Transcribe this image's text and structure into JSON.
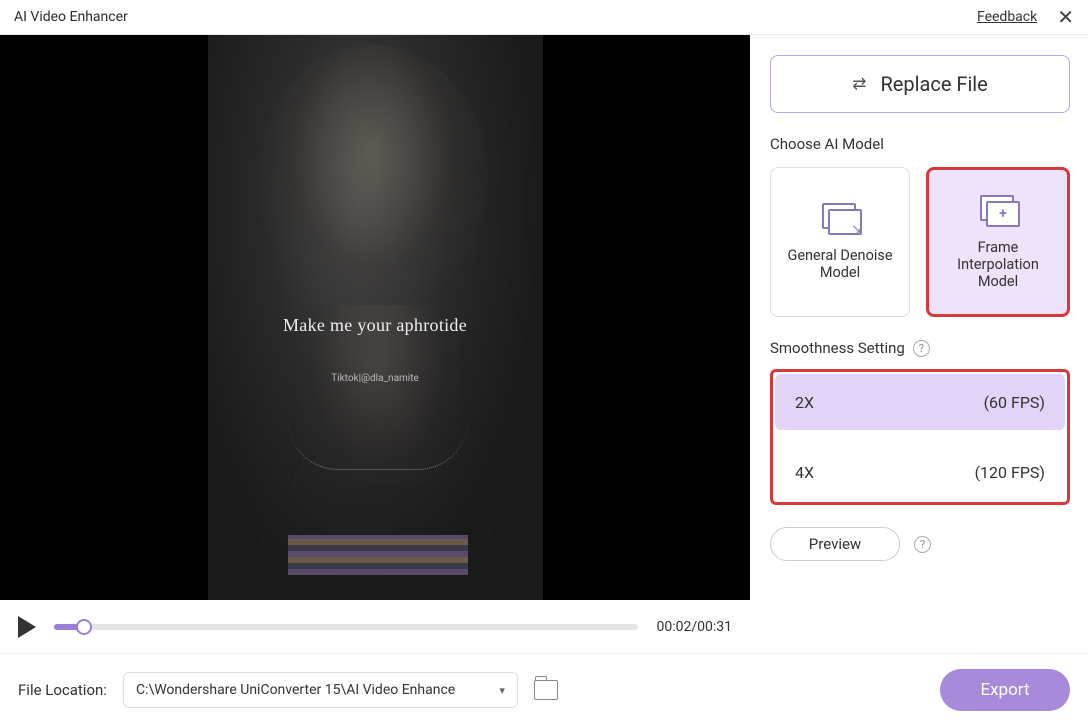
{
  "titlebar": {
    "title": "AI Video Enhancer",
    "feedback": "Feedback"
  },
  "video": {
    "overlay_text": "Make me your aphrotide",
    "overlay_sub": "Tiktok|@dla_namite",
    "time": "00:02/00:31"
  },
  "sidebar": {
    "replace_label": "Replace File",
    "choose_model_label": "Choose AI Model",
    "models": {
      "denoise": "General Denoise Model",
      "interp": "Frame Interpolation Model"
    },
    "smoothness_label": "Smoothness Setting",
    "smooth_opts": {
      "x2_label": "2X",
      "x2_fps": "(60 FPS)",
      "x4_label": "4X",
      "x4_fps": "(120 FPS)"
    },
    "preview_label": "Preview"
  },
  "footer": {
    "file_location_label": "File Location:",
    "path": "C:\\Wondershare UniConverter 15\\AI Video Enhance",
    "export_label": "Export"
  }
}
